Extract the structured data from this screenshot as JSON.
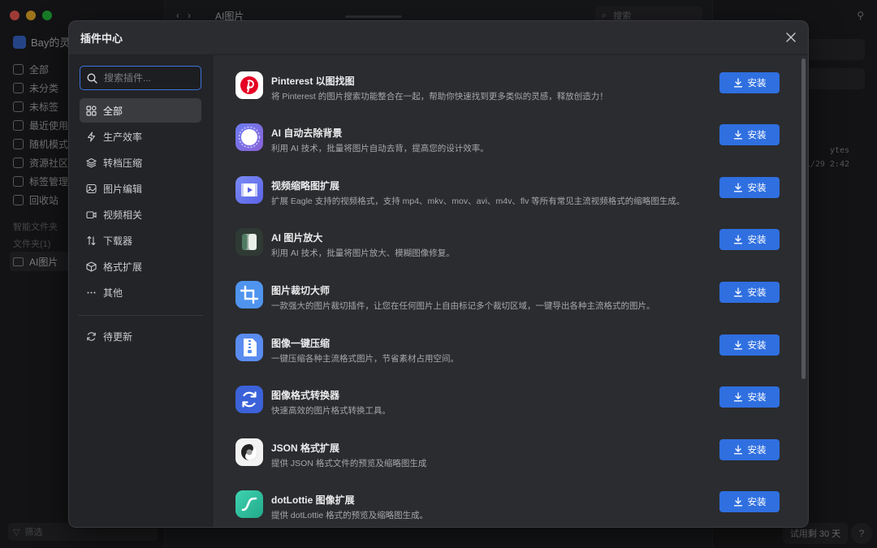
{
  "background": {
    "library_name": "Bay的灵感",
    "nav_items": [
      "全部",
      "未分类",
      "未标签",
      "最近使用",
      "随机模式",
      "资源社区",
      "标签管理",
      "回收站"
    ],
    "section_smart": "智能文件夹",
    "section_folders": "文件夹(1)",
    "folder_name": "AI图片",
    "toolbar_title": "AI图片",
    "search_placeholder": "搜索",
    "filter_placeholder": "筛选",
    "meta_size": "ytes",
    "meta_date": "1/29 2:42",
    "trial_label": "试用剩 30 天",
    "help_label": "?"
  },
  "modal": {
    "title": "插件中心",
    "search_placeholder": "搜索插件...",
    "categories": [
      {
        "label": "全部",
        "icon": "grid-icon",
        "active": true
      },
      {
        "label": "生产效率",
        "icon": "bolt-icon",
        "active": false
      },
      {
        "label": "转档压缩",
        "icon": "layers-icon",
        "active": false
      },
      {
        "label": "图片编辑",
        "icon": "image-edit-icon",
        "active": false
      },
      {
        "label": "视频相关",
        "icon": "video-icon",
        "active": false
      },
      {
        "label": "下载器",
        "icon": "arrows-updown-icon",
        "active": false
      },
      {
        "label": "格式扩展",
        "icon": "cube-icon",
        "active": false
      },
      {
        "label": "其他",
        "icon": "ellipsis-icon",
        "active": false
      }
    ],
    "pending_update": "待更新",
    "install_label": "安装",
    "plugins": [
      {
        "name": "Pinterest 以图找图",
        "desc": "将 Pinterest 的图片搜索功能整合在一起，帮助你快速找到更多类似的灵感，释放创造力！",
        "icon": "pinterest-icon"
      },
      {
        "name": "AI 自动去除背景",
        "desc": "利用 AI 技术，批量将图片自动去背，提高您的设计效率。",
        "icon": "remove-bg-icon"
      },
      {
        "name": "视频缩略图扩展",
        "desc": "扩展 Eagle 支持的视频格式，支持 mp4、mkv、mov、avi、m4v、flv 等所有常见主流视频格式的缩略图生成。",
        "icon": "video-thumb-icon"
      },
      {
        "name": "AI 图片放大",
        "desc": "利用 AI 技术，批量将图片放大、模糊图像修复。",
        "icon": "upscale-icon"
      },
      {
        "name": "图片裁切大师",
        "desc": "一款强大的图片裁切插件，让您在任何图片上自由标记多个裁切区域，一键导出各种主流格式的图片。",
        "icon": "crop-icon"
      },
      {
        "name": "图像一键压缩",
        "desc": "一键压缩各种主流格式图片，节省素材占用空间。",
        "icon": "zip-icon"
      },
      {
        "name": "图像格式转换器",
        "desc": "快速高效的图片格式转换工具。",
        "icon": "convert-icon"
      },
      {
        "name": "JSON 格式扩展",
        "desc": "提供 JSON 格式文件的预览及缩略图生成",
        "icon": "json-icon"
      },
      {
        "name": "dotLottie 图像扩展",
        "desc": "提供 dotLottie 格式的预览及缩略图生成。",
        "icon": "lottie-icon"
      }
    ]
  }
}
